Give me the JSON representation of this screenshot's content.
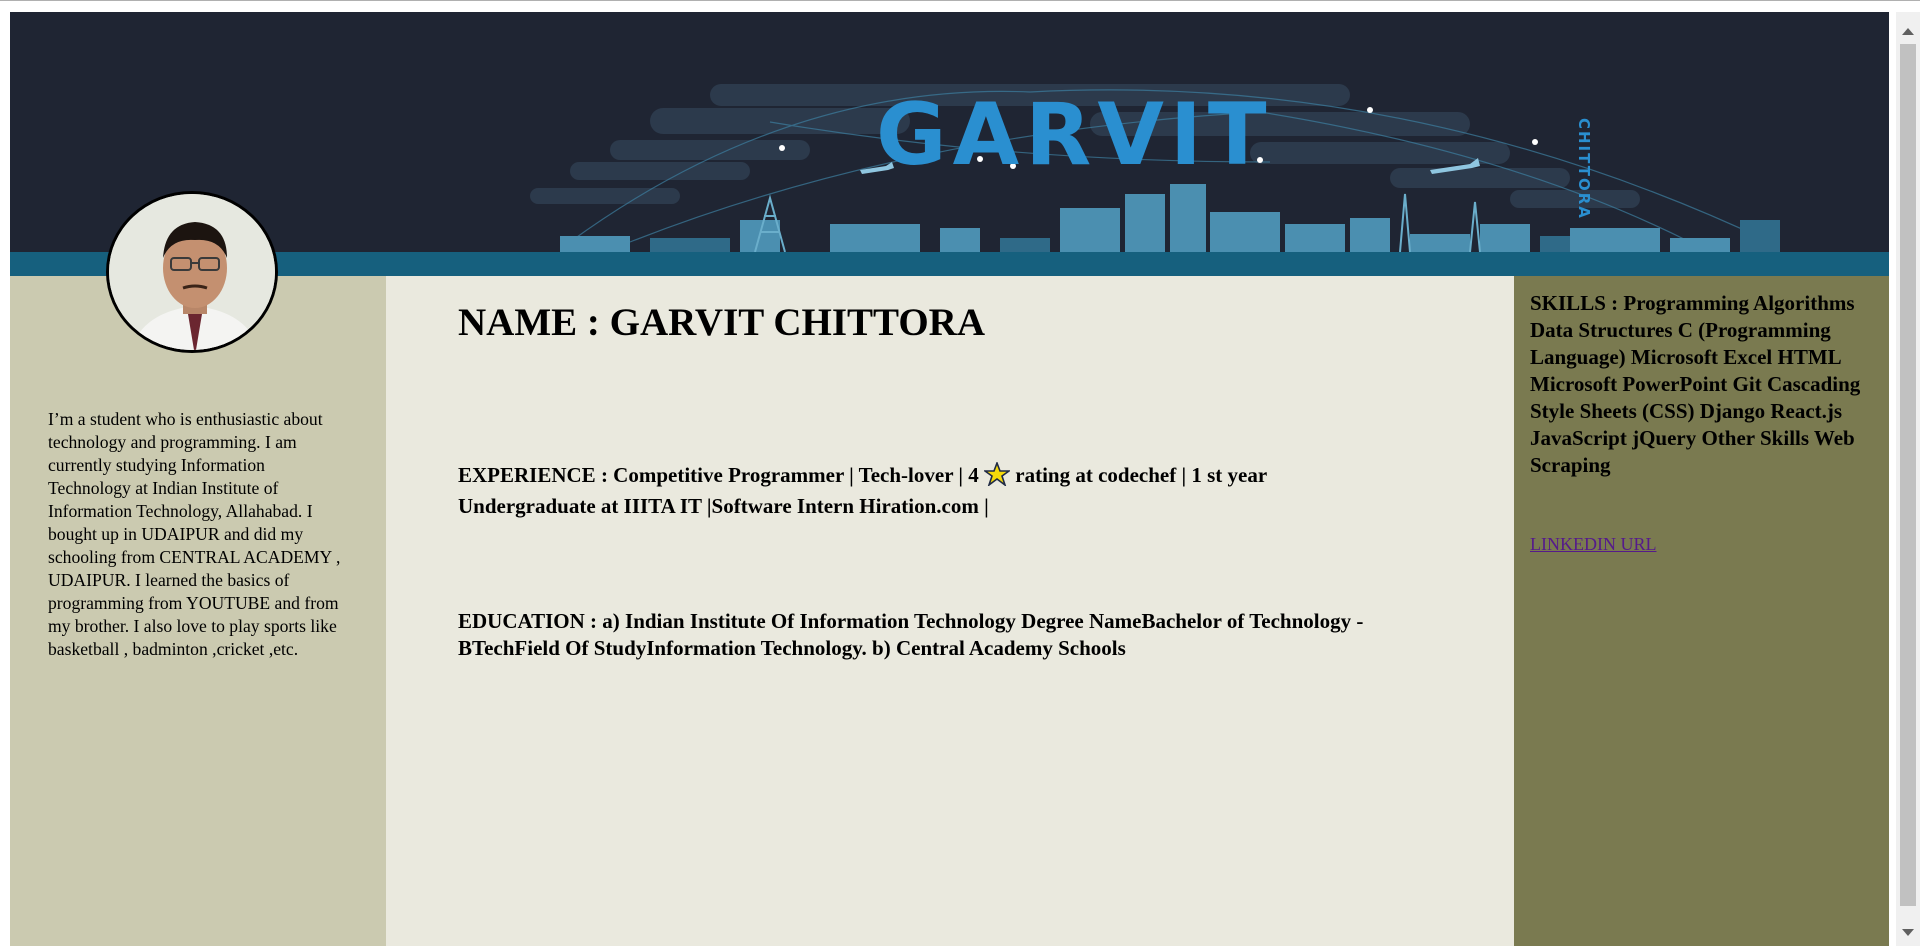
{
  "banner": {
    "title": "GARVIT",
    "subtitle_vertical": "CHITTORA"
  },
  "profile": {
    "bio": "I’m a student who is enthusiastic about technology and programming. I am currently studying Information Technology at Indian Institute of Information Technology, Allahabad. I bought up in UDAIPUR and did my schooling from CENTRAL ACADEMY , UDAIPUR. I learned the basics of programming from YOUTUBE and from my brother. I also love to play sports like basketball , badminton ,cricket ,etc."
  },
  "main": {
    "name_heading": "NAME : GARVIT CHITTORA",
    "experience_before_star": "EXPERIENCE : Competitive Programmer | Tech-lover | 4",
    "experience_after_star": "rating at codechef | 1 st year Undergraduate at IIITA IT |Software Intern Hiration.com |",
    "education": "EDUCATION : a) Indian Institute Of Information Technology Degree NameBachelor of Technology - BTechField Of StudyInformation Technology. b) Central Academy Schools"
  },
  "sidebar_right": {
    "skills": "SKILLS : Programming Algorithms Data Structures C (Programming Language) Microsoft Excel HTML Microsoft PowerPoint Git Cascading Style Sheets (CSS) Django React.js JavaScript jQuery Other Skills Web Scraping",
    "linkedin_label": "LINKEDIN URL"
  },
  "colors": {
    "banner_bg": "#1f2533",
    "banner_accent": "#16607e",
    "left_col": "#cbcab0",
    "mid_col": "#eae9de",
    "right_col": "#7a7a50",
    "link": "#551a8b"
  },
  "icons": {
    "star": "star-icon"
  }
}
